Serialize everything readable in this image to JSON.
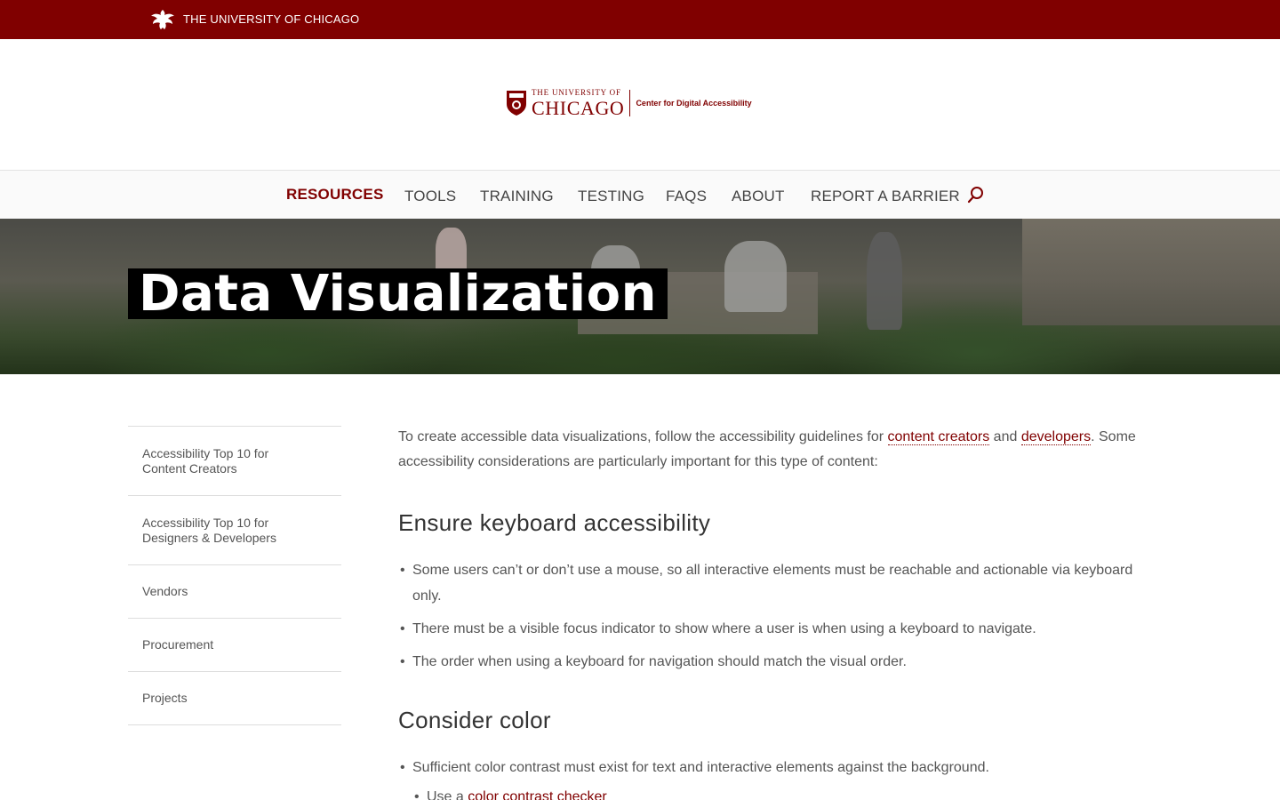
{
  "topbar": {
    "university_name": "THE UNIVERSITY OF CHICAGO"
  },
  "logo": {
    "small_line": "THE UNIVERSITY OF",
    "big_line": "CHICAGO",
    "center_name": "Center for Digital Accessibility"
  },
  "nav": {
    "items": [
      "RESOURCES",
      "TOOLS",
      "TRAINING",
      "TESTING",
      "FAQS",
      "ABOUT",
      "REPORT A BARRIER"
    ],
    "active": "RESOURCES"
  },
  "hero": {
    "title": "Data Visualization"
  },
  "sidebar": {
    "items": [
      "Accessibility Top 10 for Content Creators",
      "Accessibility Top 10 for Designers & Developers",
      "Vendors",
      "Procurement",
      "Projects"
    ]
  },
  "main": {
    "intro_before": "To create accessible data visualizations, follow the accessibility guidelines for ",
    "link_content_creators": "content creators",
    "intro_and": " and ",
    "link_developers": "developers",
    "intro_after": ". Some accessibility considerations are particularly important for this type of content:",
    "section1_heading": "Ensure keyboard accessibility",
    "section1_items": [
      "Some users can’t or don’t use a mouse, so all interactive elements must be reachable and actionable via keyboard only.",
      "There must be a visible focus indicator to show where a user is when using a keyboard to navigate.",
      "The order when using a keyboard for navigation should match the visual order."
    ],
    "section2_heading": "Consider color",
    "section2_items": [
      "Sufficient color contrast must exist for text and interactive elements against the background."
    ],
    "section2_sub_before": "Use a ",
    "section2_sub_link": "color contrast checker"
  },
  "colors": {
    "brand": "#800000"
  }
}
